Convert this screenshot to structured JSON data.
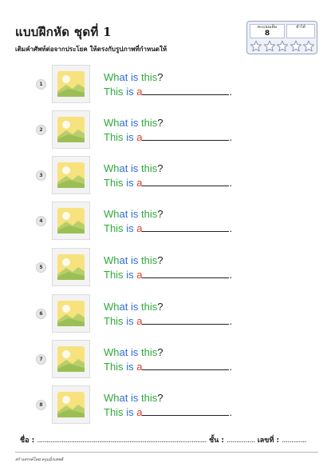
{
  "header": {
    "title": "แบบฝึกหัด ชุดที่ 1",
    "instruction": "เติมคำศัพท์ต่อจากประโยค ให้ตรงกับรูปภาพที่กำหนดให้"
  },
  "score": {
    "full_label": "คะแนนเต็ม",
    "full_value": "8",
    "got_label": "ทำได้",
    "got_value": "",
    "stars": 5
  },
  "exercises": [
    {
      "number": "1",
      "q_wh": "Wh",
      "q_at": "at",
      "q_is": "is",
      "q_this": "this",
      "q_mark": "?",
      "a_this": "This",
      "a_is": "is",
      "a_a": "a",
      "a_end": ".",
      "image": "image-placeholder-icon"
    },
    {
      "number": "2",
      "q_wh": "Wh",
      "q_at": "at",
      "q_is": "is",
      "q_this": "this",
      "q_mark": "?",
      "a_this": "This",
      "a_is": "is",
      "a_a": "a",
      "a_end": ".",
      "image": "image-placeholder-icon"
    },
    {
      "number": "3",
      "q_wh": "Wh",
      "q_at": "at",
      "q_is": "is",
      "q_this": "this",
      "q_mark": "?",
      "a_this": "This",
      "a_is": "is",
      "a_a": "a",
      "a_end": ".",
      "image": "image-placeholder-icon"
    },
    {
      "number": "4",
      "q_wh": "Wh",
      "q_at": "at",
      "q_is": "is",
      "q_this": "this",
      "q_mark": "?",
      "a_this": "This",
      "a_is": "is",
      "a_a": "a",
      "a_end": ".",
      "image": "image-placeholder-icon"
    },
    {
      "number": "5",
      "q_wh": "Wh",
      "q_at": "at",
      "q_is": "is",
      "q_this": "this",
      "q_mark": "?",
      "a_this": "This",
      "a_is": "is",
      "a_a": "a",
      "a_end": ".",
      "image": "image-placeholder-icon"
    },
    {
      "number": "6",
      "q_wh": "Wh",
      "q_at": "at",
      "q_is": "is",
      "q_this": "this",
      "q_mark": "?",
      "a_this": "This",
      "a_is": "is",
      "a_a": "a",
      "a_end": ".",
      "image": "image-placeholder-icon"
    },
    {
      "number": "7",
      "q_wh": "Wh",
      "q_at": "at",
      "q_is": "is",
      "q_this": "this",
      "q_mark": "?",
      "a_this": "This",
      "a_is": "is",
      "a_a": "a",
      "a_end": ".",
      "image": "image-placeholder-icon"
    },
    {
      "number": "8",
      "q_wh": "Wh",
      "q_at": "at",
      "q_is": "is",
      "q_this": "this",
      "q_mark": "?",
      "a_this": "This",
      "a_is": "is",
      "a_a": "a",
      "a_end": ".",
      "image": "image-placeholder-icon"
    }
  ],
  "footer": {
    "name_label": "ชื่อ :",
    "name_dots": "..........................................................................................",
    "class_label": "ชั้น :",
    "class_dots": "...............",
    "number_label": "เลขที่ :",
    "number_dots": ".............",
    "credit": "สร้างสรรค์โดย:ครูแม็กเทพลิ"
  },
  "colors": {
    "question_wh": "#2eaa3a",
    "question_word": "#2f6fd0",
    "answer_article": "#e03a2a",
    "score_box": "#eef1f8"
  }
}
